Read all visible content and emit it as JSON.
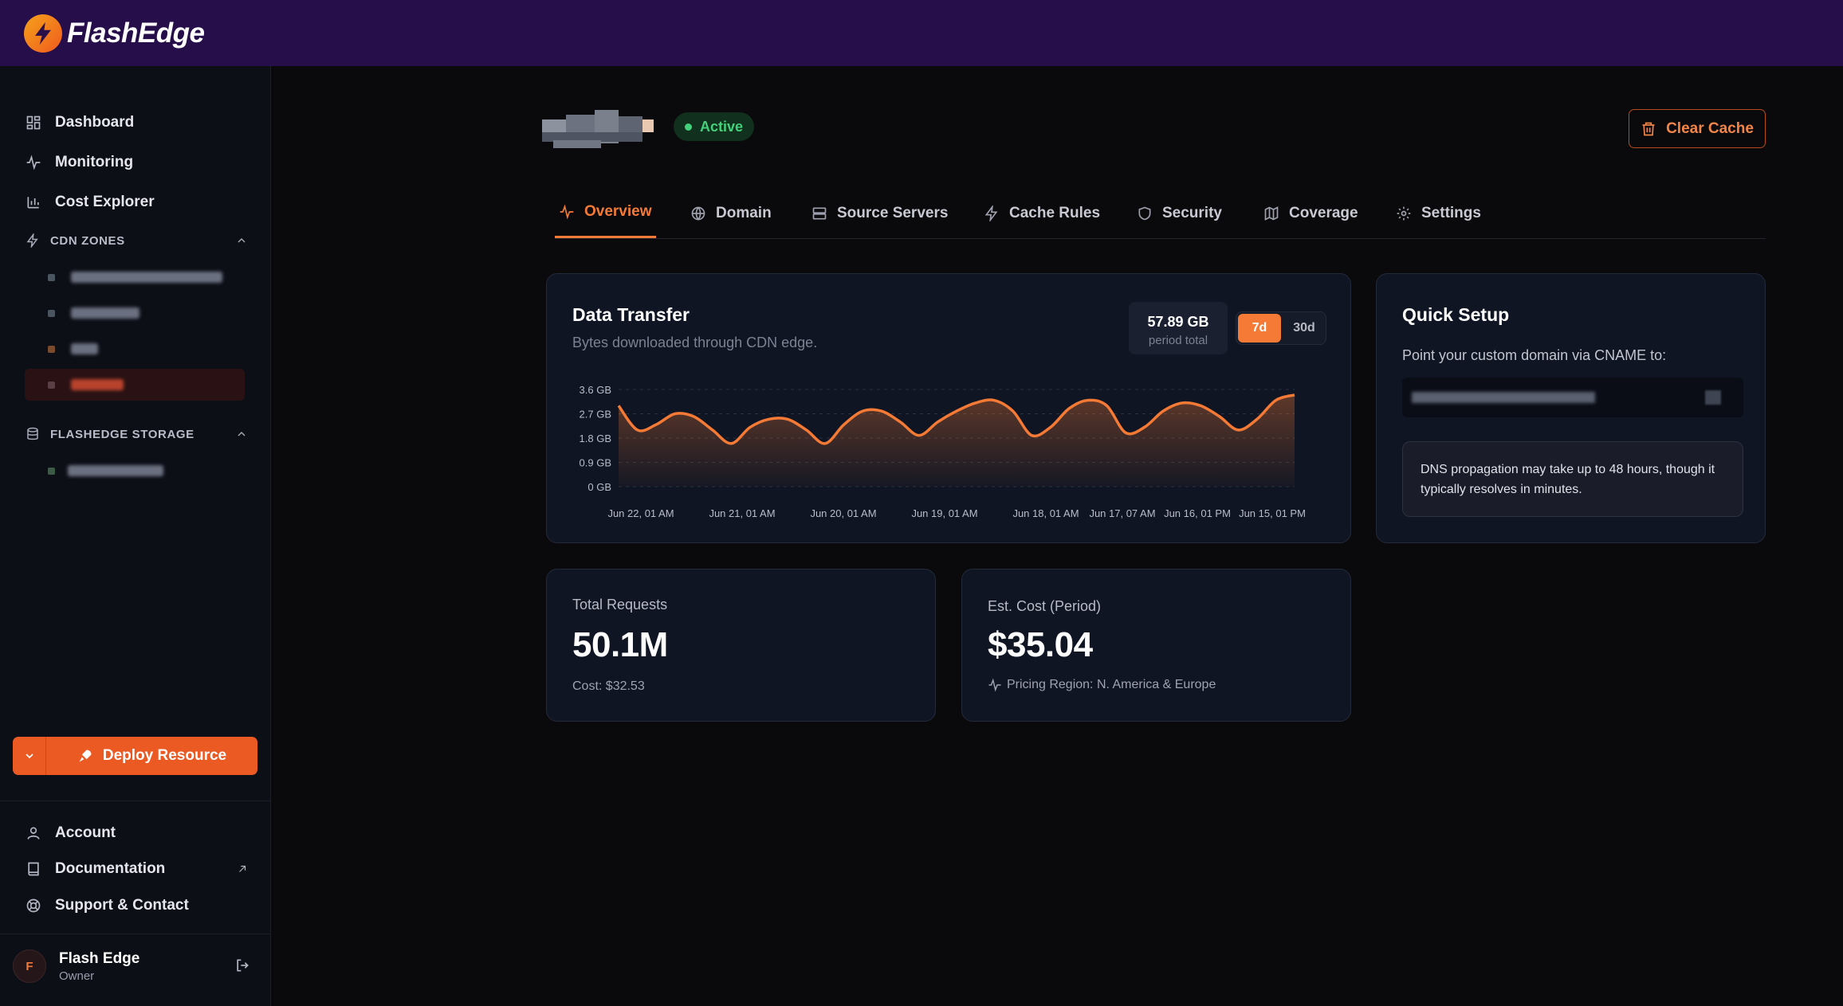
{
  "app": {
    "name": "FlashEdge"
  },
  "sidebar": {
    "nav": [
      {
        "label": "Dashboard",
        "icon": "dashboard-icon"
      },
      {
        "label": "Monitoring",
        "icon": "activity-icon"
      },
      {
        "label": "Cost Explorer",
        "icon": "bar-chart-icon"
      }
    ],
    "cdn_zones_heading": "CDN ZONES",
    "storage_heading": "FLASHEDGE STORAGE",
    "deploy_label": "Deploy Resource",
    "bottom": [
      {
        "label": "Account",
        "icon": "user-icon"
      },
      {
        "label": "Documentation",
        "icon": "book-icon"
      },
      {
        "label": "Support & Contact",
        "icon": "lifebuoy-icon"
      }
    ],
    "user": {
      "initial": "F",
      "name": "Flash Edge",
      "role": "Owner"
    }
  },
  "zone": {
    "status": "Active"
  },
  "header": {
    "clear_cache": "Clear Cache"
  },
  "tabs": [
    {
      "label": "Overview",
      "active": true
    },
    {
      "label": "Domain"
    },
    {
      "label": "Source Servers"
    },
    {
      "label": "Cache Rules"
    },
    {
      "label": "Security"
    },
    {
      "label": "Coverage"
    },
    {
      "label": "Settings"
    }
  ],
  "data_transfer": {
    "title": "Data Transfer",
    "subtitle": "Bytes downloaded through CDN edge.",
    "period_total": "57.89 GB",
    "period_total_label": "period total",
    "range_options": [
      "7d",
      "30d"
    ],
    "selected_range": "7d"
  },
  "chart_data": {
    "type": "area",
    "y_ticks": [
      "3.6 GB",
      "2.7 GB",
      "1.8 GB",
      "0.9 GB",
      "0 GB"
    ],
    "ylim": [
      0,
      3.6
    ],
    "x_tick_labels": [
      "Jun 22, 01 AM",
      "Jun 21, 01 AM",
      "Jun 20, 01 AM",
      "Jun 19, 01 AM",
      "Jun 18, 01 AM",
      "Jun 17, 07 AM",
      "Jun 16, 01 PM",
      "Jun 15, 01 PM"
    ],
    "values": [
      3.0,
      2.1,
      2.3,
      2.7,
      2.6,
      2.1,
      1.6,
      2.2,
      2.5,
      2.5,
      2.1,
      1.6,
      2.3,
      2.8,
      2.8,
      2.4,
      1.9,
      2.4,
      2.8,
      3.1,
      3.2,
      2.8,
      1.9,
      2.2,
      2.9,
      3.2,
      3.0,
      2.0,
      2.2,
      2.8,
      3.1,
      3.0,
      2.6,
      2.1,
      2.5,
      3.2,
      3.4
    ],
    "series_color": "#f47a35",
    "grid": true
  },
  "quick_setup": {
    "title": "Quick Setup",
    "subtitle": "Point your custom domain via CNAME to:",
    "note": "DNS propagation may take up to 48 hours, though it typically resolves in minutes."
  },
  "metrics": {
    "requests": {
      "label": "Total Requests",
      "value": "50.1M",
      "footer": "Cost: $32.53"
    },
    "cost": {
      "label": "Est. Cost (Period)",
      "value": "$35.04",
      "footer": "Pricing Region: N. America & Europe"
    }
  },
  "colors": {
    "accent": "#f47a35",
    "topbar": "#260e4a",
    "active_green": "#42d17a"
  }
}
